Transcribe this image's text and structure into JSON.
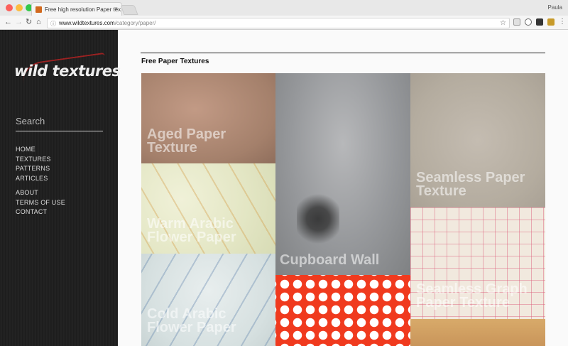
{
  "browser": {
    "tab_title": "Free high resolution Paper tex",
    "user": "Paula",
    "url_host": "www.wildtextures.com",
    "url_path": "/category/paper/"
  },
  "sidebar": {
    "logo": "wild textures",
    "search_placeholder": "Search",
    "nav_primary": [
      "HOME",
      "TEXTURES",
      "PATTERNS",
      "ARTICLES"
    ],
    "nav_secondary": [
      "ABOUT",
      "TERMS OF USE",
      "CONTACT"
    ]
  },
  "main": {
    "heading": "Free Paper Textures",
    "tiles": [
      {
        "label": "Aged Paper\nTexture"
      },
      {
        "label": "Warm Arabic\nFlower Paper"
      },
      {
        "label": "Cold Arabic\nFlower Paper"
      },
      {
        "label": "Cupboard Wall"
      },
      {
        "label": "Seamless Paper\nTexture"
      },
      {
        "label": "Seamless Graph\nPaper Texture"
      }
    ]
  },
  "colors": {
    "accent": "#b22222",
    "sidebar_bg": "#1f1f1f",
    "polka_bg": "#f03a1e"
  }
}
